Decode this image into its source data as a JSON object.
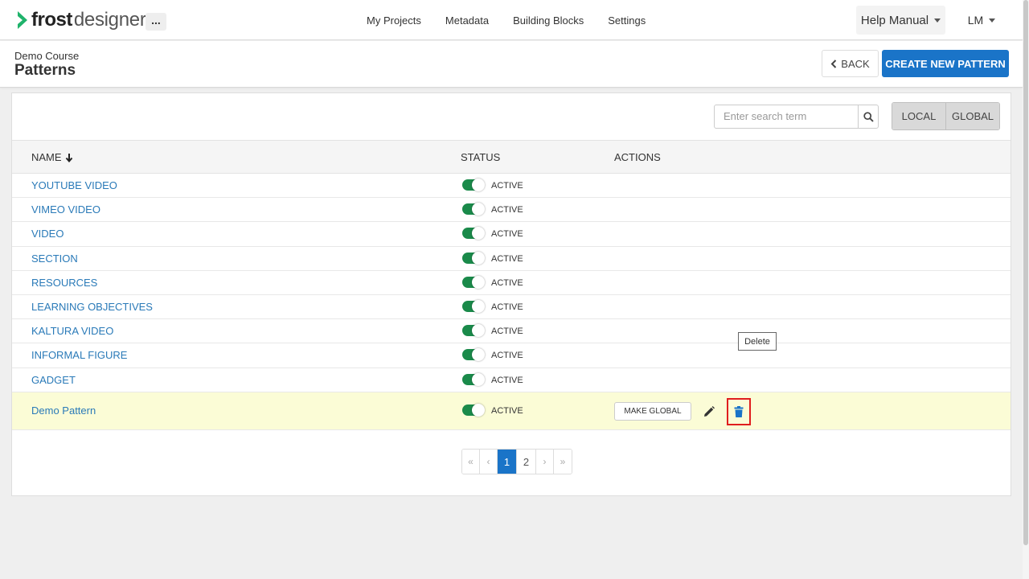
{
  "app": {
    "brand_frost": "frost",
    "brand_designer": "designer"
  },
  "nav": {
    "more_label": "...",
    "links": [
      "My Projects",
      "Metadata",
      "Building Blocks",
      "Settings"
    ],
    "help_label": "Help Manual",
    "user_label": "LM"
  },
  "subheader": {
    "course": "Demo Course",
    "title": "Patterns",
    "back_label": "BACK",
    "create_label": "CREATE NEW PATTERN"
  },
  "search": {
    "placeholder": "Enter search term"
  },
  "scope": {
    "local": "LOCAL",
    "global": "GLOBAL"
  },
  "table": {
    "headers": {
      "name": "NAME",
      "status": "STATUS",
      "actions": "ACTIONS"
    },
    "rows": [
      {
        "name": "YOUTUBE VIDEO",
        "status": "ACTIVE"
      },
      {
        "name": "VIMEO VIDEO",
        "status": "ACTIVE"
      },
      {
        "name": "VIDEO",
        "status": "ACTIVE"
      },
      {
        "name": "SECTION",
        "status": "ACTIVE"
      },
      {
        "name": "RESOURCES",
        "status": "ACTIVE"
      },
      {
        "name": "LEARNING OBJECTIVES",
        "status": "ACTIVE"
      },
      {
        "name": "KALTURA VIDEO",
        "status": "ACTIVE"
      },
      {
        "name": "INFORMAL FIGURE",
        "status": "ACTIVE"
      },
      {
        "name": "GADGET",
        "status": "ACTIVE"
      },
      {
        "name": "Demo Pattern",
        "status": "ACTIVE"
      }
    ],
    "make_global_label": "MAKE GLOBAL",
    "tooltip": "Delete"
  },
  "pager": {
    "first": "«",
    "prev": "‹",
    "pages": [
      "1",
      "2"
    ],
    "next": "›",
    "last": "»"
  },
  "colors": {
    "brand_green": "#1fb36b",
    "primary_blue": "#1a74c8",
    "toggle_on": "#1a8a4a",
    "highlight_row": "#fbfcd6",
    "delete_outline": "#e01e1e"
  }
}
